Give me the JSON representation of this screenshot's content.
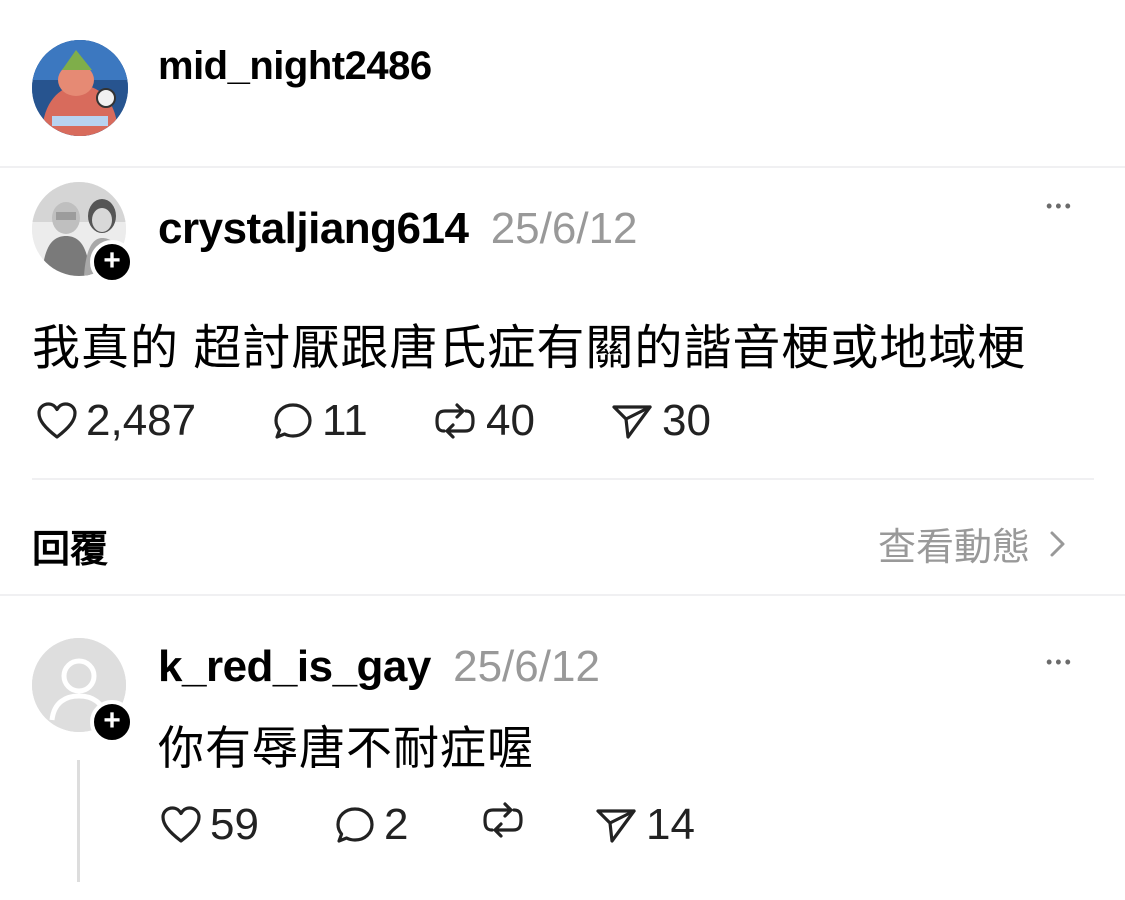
{
  "header": {
    "username": "mid_night2486"
  },
  "post": {
    "username": "crystaljiang614",
    "date": "25/6/12",
    "text": "我真的 超討厭跟唐氏症有關的諧音梗或地域梗",
    "stats": {
      "likes": "2,487",
      "comments": "11",
      "reposts": "40",
      "shares": "30"
    },
    "more": "•••"
  },
  "reply_bar": {
    "reply_label": "回覆",
    "view_activity": "查看動態"
  },
  "reply": {
    "username": "k_red_is_gay",
    "date": "25/6/12",
    "text": "你有辱唐不耐症喔",
    "stats": {
      "likes": "59",
      "comments": "2",
      "shares": "14"
    },
    "more": "•••"
  },
  "colors": {
    "text": "#000000",
    "muted": "#999999",
    "divider": "#f0f0f2"
  }
}
